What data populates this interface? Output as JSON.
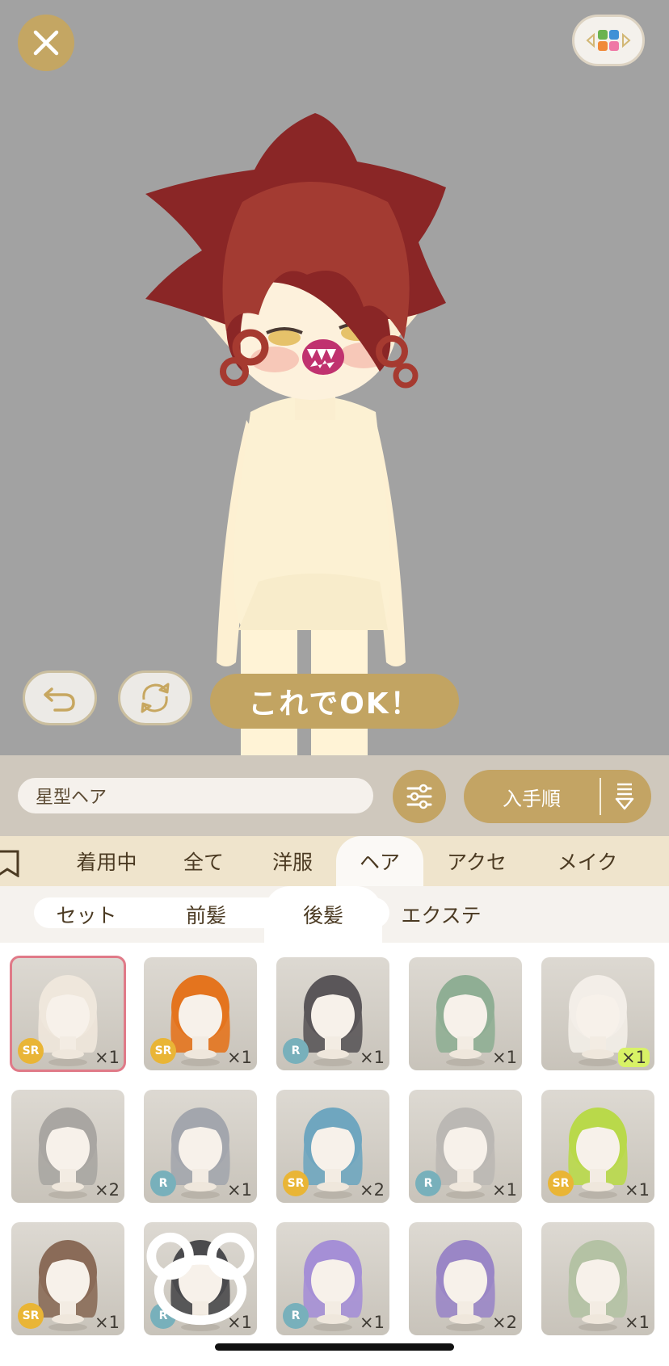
{
  "colors": {
    "accent": "#c3a464",
    "stage_bg": "#a2a2a2",
    "selected_outline": "#e07a88",
    "sr_badge": "#e9b536",
    "r_badge": "#78b0bb"
  },
  "stage": {
    "ok_button": "これでOK！",
    "undo_icon": "undo-icon",
    "refresh_icon": "refresh-icon",
    "background_icon": "background-color-icon"
  },
  "toolbar": {
    "search_value": "星型ヘア",
    "sort_label": "入手順"
  },
  "categories": [
    "着用中",
    "全て",
    "洋服",
    "ヘア",
    "アクセ",
    "メイク"
  ],
  "active_category": "ヘア",
  "subcategories": [
    "セット",
    "前髪",
    "後髪",
    "エクステ"
  ],
  "active_subcategory": "後髪",
  "items": [
    {
      "rarity": "SR",
      "qty": "×1",
      "hair": "#efe7dc",
      "selected": true
    },
    {
      "rarity": "SR",
      "qty": "×1",
      "hair": "#e4741e"
    },
    {
      "rarity": "R",
      "qty": "×1",
      "hair": "#5a5659"
    },
    {
      "rarity": "",
      "qty": "×1",
      "hair": "#8fae94"
    },
    {
      "rarity": "",
      "qty": "×1",
      "hair": "#f3eee8",
      "highlight": true
    },
    {
      "rarity": "",
      "qty": "×2",
      "hair": "#a9a6a2"
    },
    {
      "rarity": "R",
      "qty": "×1",
      "hair": "#a3a6ad"
    },
    {
      "rarity": "SR",
      "qty": "×2",
      "hair": "#6fa6bf"
    },
    {
      "rarity": "R",
      "qty": "×1",
      "hair": "#bbb8b4"
    },
    {
      "rarity": "SR",
      "qty": "×1",
      "hair": "#b9d94a"
    },
    {
      "rarity": "SR",
      "qty": "×1",
      "hair": "#8a6b58"
    },
    {
      "rarity": "R",
      "qty": "×1",
      "hair": "#4a4a4d",
      "bear": true
    },
    {
      "rarity": "R",
      "qty": "×1",
      "hair": "#a58fd6"
    },
    {
      "rarity": "",
      "qty": "×2",
      "hair": "#9a86c6"
    },
    {
      "rarity": "",
      "qty": "×1",
      "hair": "#b4c2a4"
    }
  ]
}
